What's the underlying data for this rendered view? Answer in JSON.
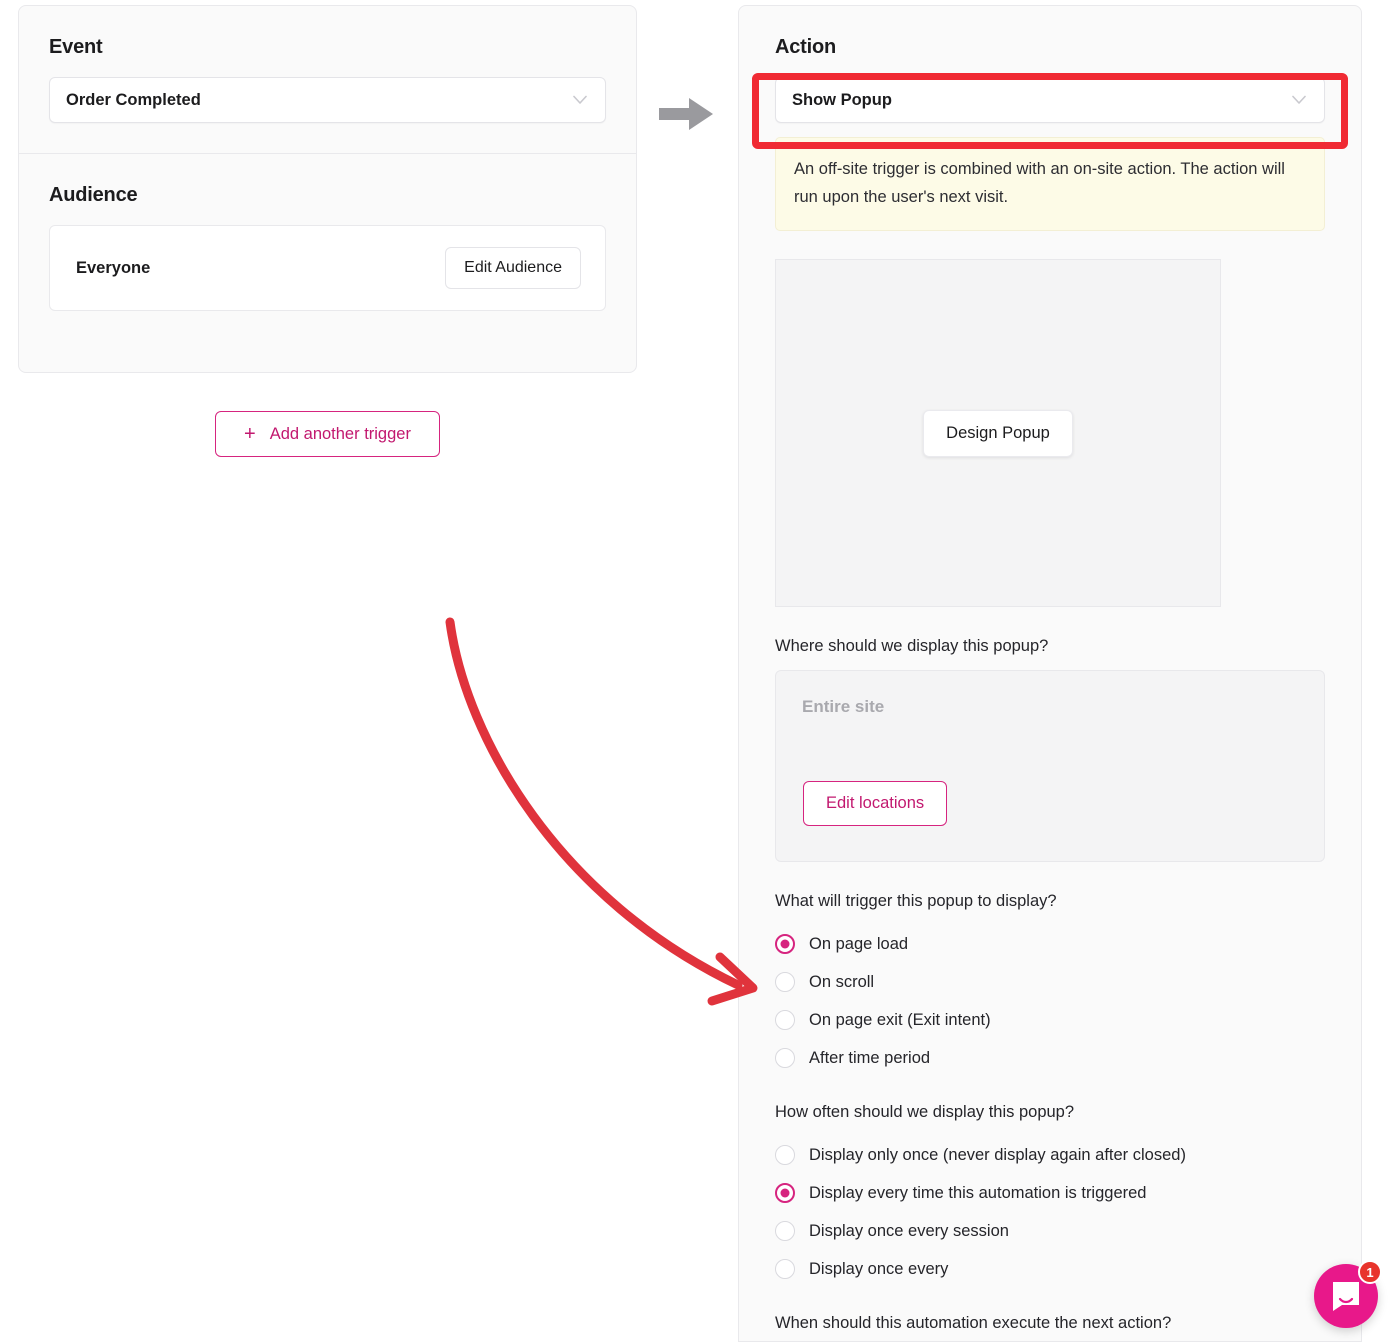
{
  "trigger": {
    "event": {
      "title": "Event",
      "selected": "Order Completed",
      "chevron_icon": "chevron-down-icon"
    },
    "audience": {
      "title": "Audience",
      "value": "Everyone",
      "edit_label": "Edit Audience"
    },
    "add_trigger_label": "Add another trigger",
    "add_trigger_plus": "+"
  },
  "flow": {
    "arrow_icon": "arrow-right-icon"
  },
  "action": {
    "title": "Action",
    "selected": "Show Popup",
    "chevron_icon": "chevron-down-icon",
    "notice": "An off-site trigger is combined with an on-site action. The action will run upon the user's next visit.",
    "design_button_label": "Design Popup",
    "where_question": "Where should we display this popup?",
    "location_value": "Entire site",
    "edit_locations_label": "Edit locations",
    "trigger_question": "What will trigger this popup to display?",
    "trigger_options": [
      {
        "label": "On page load",
        "checked": true
      },
      {
        "label": "On scroll",
        "checked": false
      },
      {
        "label": "On page exit (Exit intent)",
        "checked": false
      },
      {
        "label": "After time period",
        "checked": false
      }
    ],
    "frequency_question": "How often should we display this popup?",
    "frequency_options": [
      {
        "label": "Display only once (never display again after closed)",
        "checked": false
      },
      {
        "label": "Display every time this automation is triggered",
        "checked": true
      },
      {
        "label": "Display once every session",
        "checked": false
      },
      {
        "label": "Display once every",
        "checked": false
      }
    ],
    "next_action_question": "When should this automation execute the next action?"
  },
  "annotation": {
    "highlight_color": "#f02a33",
    "arrow_color": "#e0333c",
    "arrow_icon": "curved-arrow-annotation"
  },
  "intercom": {
    "icon": "intercom-messenger-icon",
    "badge_count": "1",
    "brand_color": "#e8188a"
  },
  "theme": {
    "accent_pink": "#d6247f",
    "panel_bg": "#fafafa",
    "notice_bg": "#fdfbe7"
  }
}
